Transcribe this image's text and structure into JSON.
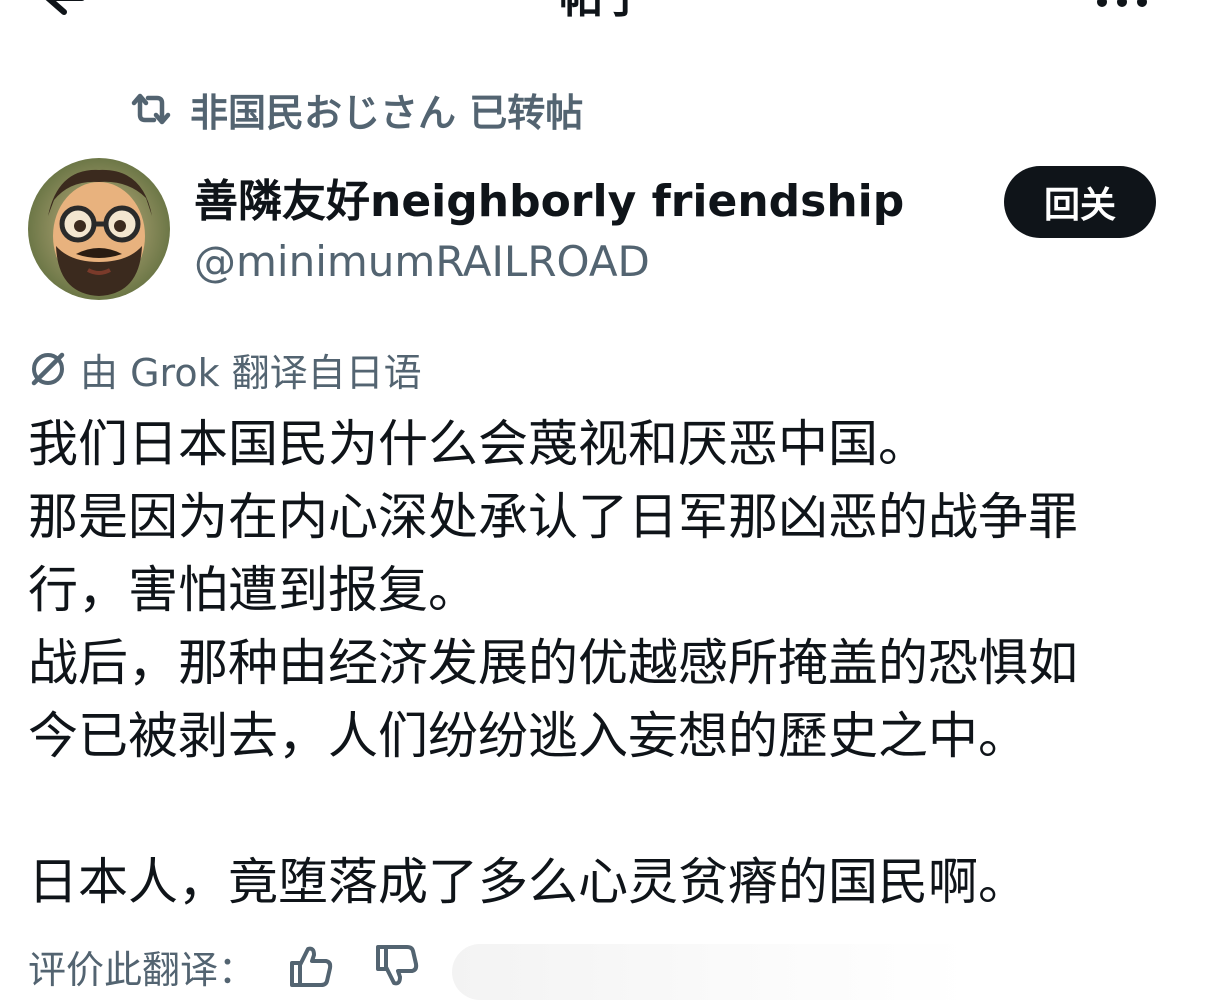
{
  "header": {
    "title": "帖子"
  },
  "repost": {
    "text": "非国民おじさん 已转帖"
  },
  "author": {
    "display_name": "善隣友好neighborly friendship",
    "handle": "@minimumRAILROAD",
    "follow_label": "回关"
  },
  "translation": {
    "label": "由 Grok 翻译自日语"
  },
  "post": {
    "lines": [
      "我们日本国民为什么会蔑视和厌恶中国。",
      "那是因为在内心深处承认了日军那凶恶的战争罪",
      "行，害怕遭到报复。",
      "战后，那种由经济发展的优越感所掩盖的恐惧如",
      "今已被剥去，人们纷纷逃入妄想的歷史之中。",
      "",
      "日本人，竟堕落成了多么心灵贫瘠的国民啊。"
    ]
  },
  "rating": {
    "label": "评价此翻译："
  },
  "icons": {
    "back": "back-arrow-icon",
    "more": "more-icon",
    "repost": "repost-icon",
    "grok": "grok-icon",
    "thumbs_up": "thumbs-up-icon",
    "thumbs_down": "thumbs-down-icon"
  },
  "colors": {
    "text_primary": "#0f1419",
    "text_secondary": "#536471",
    "button_bg": "#0f1419",
    "button_text": "#ffffff"
  }
}
